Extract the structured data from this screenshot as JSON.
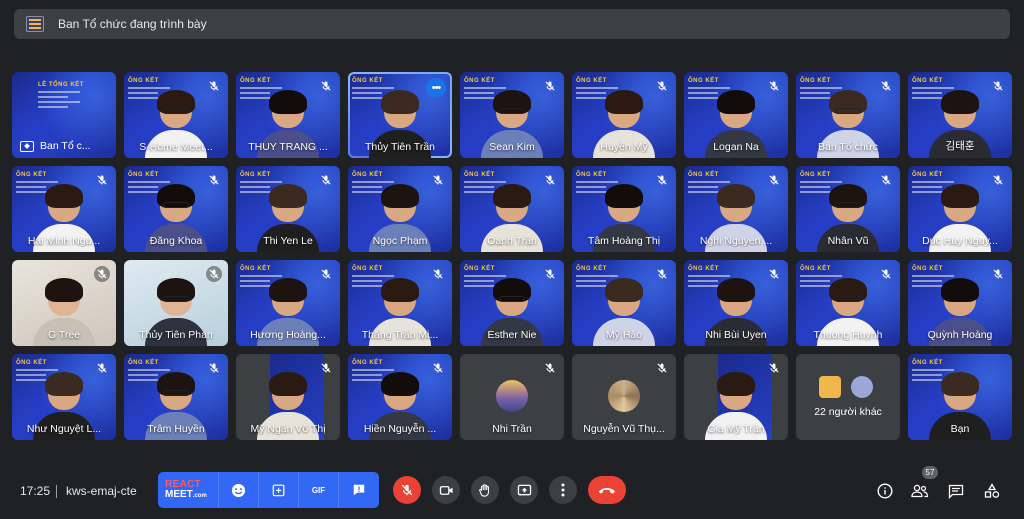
{
  "banner": {
    "text": "Ban Tổ chức đang trình bày"
  },
  "slide": {
    "heading": "ÔNG KẾT",
    "heading_alt": "LỄ TỔNG KẾT"
  },
  "tiles": [
    {
      "name": "Ban Tổ c...",
      "kind": "present"
    },
    {
      "name": "S-Home Meet...",
      "kind": "video"
    },
    {
      "name": "THUY TRANG ...",
      "kind": "video"
    },
    {
      "name": "Thủy Tiên Trần",
      "kind": "video",
      "active": true
    },
    {
      "name": "Sean Kim",
      "kind": "video"
    },
    {
      "name": "Huyền Mỹ",
      "kind": "video"
    },
    {
      "name": "Logan Na",
      "kind": "video"
    },
    {
      "name": "Ban Tổ chức",
      "kind": "video"
    },
    {
      "name": "김태훈",
      "kind": "video"
    },
    {
      "name": "Hai Minh Ngu...",
      "kind": "video"
    },
    {
      "name": "Đăng Khoa",
      "kind": "video"
    },
    {
      "name": "Thi Yen Le",
      "kind": "video"
    },
    {
      "name": "Ngọc Phạm",
      "kind": "video"
    },
    {
      "name": "Oanh Trần",
      "kind": "video"
    },
    {
      "name": "Tâm Hoàng Thị",
      "kind": "video"
    },
    {
      "name": "Nghi Nguyen ...",
      "kind": "video"
    },
    {
      "name": "Nhân Vũ",
      "kind": "video"
    },
    {
      "name": "Duc Huy Nguy...",
      "kind": "video"
    },
    {
      "name": "G Tree",
      "kind": "real"
    },
    {
      "name": "Thủy Tiên Phan",
      "kind": "real2"
    },
    {
      "name": "Hương Hoàng...",
      "kind": "video"
    },
    {
      "name": "Thắng Trần Mi...",
      "kind": "video"
    },
    {
      "name": "Esther Nie",
      "kind": "video"
    },
    {
      "name": "Mỹ Hảo",
      "kind": "video"
    },
    {
      "name": "Nhi Bùi Uyen",
      "kind": "video"
    },
    {
      "name": "Thuong Huynh",
      "kind": "video"
    },
    {
      "name": "Quỳnh Hoàng",
      "kind": "video"
    },
    {
      "name": "Như Nguyệt L...",
      "kind": "video"
    },
    {
      "name": "Trâm Huyền",
      "kind": "video"
    },
    {
      "name": "Mỹ Ngân Võ Thị",
      "kind": "darkvideo"
    },
    {
      "name": "Hiền Nguyễn ...",
      "kind": "video"
    },
    {
      "name": "Nhi Trần",
      "kind": "avatar"
    },
    {
      "name": "Nguyễn Vũ Thụ...",
      "kind": "avatar2"
    },
    {
      "name": "Gia Mỹ Trần",
      "kind": "darkvideo"
    },
    {
      "name": "22 người khác",
      "kind": "others"
    },
    {
      "name": "Bạn",
      "kind": "video",
      "nomic": true
    }
  ],
  "bottom": {
    "time": "17:25",
    "meeting_code": "kws-emaj-cte",
    "react_line1": "REACT",
    "react_line2": "MEET",
    "react_line2_suffix": ".com",
    "gif_label": "GIF",
    "people_count": "57"
  },
  "colors": {
    "background": "#202124",
    "tile": "#3c4043",
    "accent": "#3367f5",
    "danger": "#ea4335",
    "active": "#8ab4f8"
  }
}
